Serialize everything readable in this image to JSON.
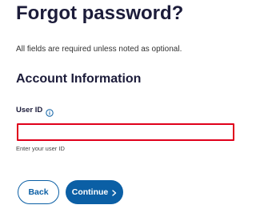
{
  "page": {
    "title": "Forgot password?",
    "required_note": "All fields are required unless noted as optional."
  },
  "section": {
    "title": "Account Information"
  },
  "user_id_field": {
    "label": "User ID",
    "value": "",
    "placeholder": "",
    "helper": "Enter your user ID",
    "info_icon": "info-circle-icon",
    "error_color": "#e0001b"
  },
  "actions": {
    "back_label": "Back",
    "continue_label": "Continue",
    "continue_icon": "chevron-right-icon",
    "primary_color": "#0b5fa5"
  }
}
